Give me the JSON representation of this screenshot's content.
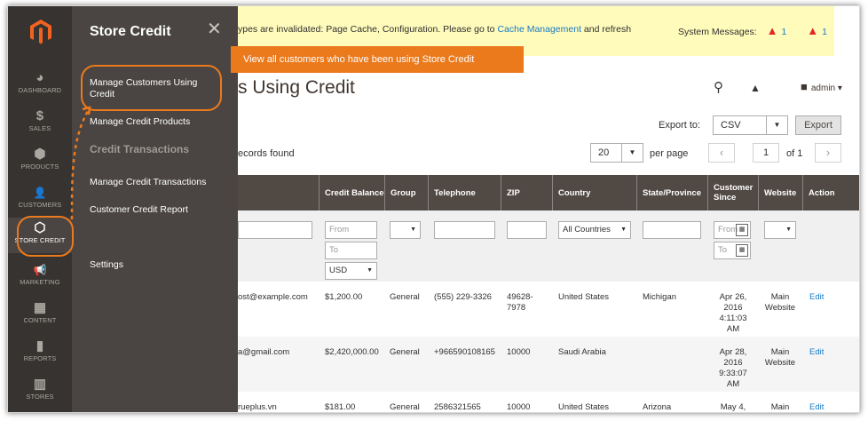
{
  "nav": {
    "items": [
      {
        "label": "DASHBOARD",
        "icon": "dashboard-icon",
        "glyph": "◕"
      },
      {
        "label": "SALES",
        "icon": "dollar-icon",
        "glyph": "$"
      },
      {
        "label": "PRODUCTS",
        "icon": "cube-icon",
        "glyph": "⬢"
      },
      {
        "label": "CUSTOMERS",
        "icon": "person-icon",
        "glyph": "👤"
      },
      {
        "label": "STORE CREDIT",
        "icon": "hexagon-icon",
        "glyph": "⬡"
      },
      {
        "label": "MARKETING",
        "icon": "megaphone-icon",
        "glyph": "📢"
      },
      {
        "label": "CONTENT",
        "icon": "layout-icon",
        "glyph": "▦"
      },
      {
        "label": "REPORTS",
        "icon": "bar-chart-icon",
        "glyph": "▮"
      },
      {
        "label": "STORES",
        "icon": "store-icon",
        "glyph": "▥"
      }
    ]
  },
  "flyout": {
    "title": "Store Credit",
    "close": "✕",
    "links": {
      "manage_customers": "Manage Customers Using Credit",
      "manage_products": "Manage Credit Products",
      "section": "Credit Transactions",
      "manage_transactions": "Manage Credit Transactions",
      "report": "Customer Credit Report",
      "settings": "Settings"
    }
  },
  "message": {
    "text": "ypes are invalidated: Page Cache, Configuration. Please go to ",
    "link": "Cache Management",
    "after": " and refresh",
    "system_label": "System Messages:",
    "count1": "1",
    "count2": "1"
  },
  "tooltip": "View all customers who have been using Store Credit",
  "page_title": "s Using Credit",
  "header": {
    "admin": "admin ▾"
  },
  "toolbar": {
    "export_label": "Export to:",
    "export_value": "CSV",
    "export_button": "Export",
    "records": "ecords found",
    "per_page_value": "20",
    "per_page_label": "per page",
    "page_value": "1",
    "of": "of 1"
  },
  "columns": [
    "Credit Balance",
    "Group",
    "Telephone",
    "ZIP",
    "Country",
    "State/Province",
    "Customer Since",
    "Website",
    "Action"
  ],
  "filters": {
    "from": "From",
    "to": "To",
    "currency": "USD",
    "country": "All Countries",
    "since_from": "From",
    "since_to": "To"
  },
  "rows": [
    {
      "email": "ost@example.com",
      "balance": "$1,200.00",
      "group": "General",
      "phone": "(555) 229-3326",
      "zip": "49628-7978",
      "country": "United States",
      "state": "Michigan",
      "since": "Apr 26, 2016 4:11:03 AM",
      "website": "Main Website",
      "action": "Edit"
    },
    {
      "email": "a@gmail.com",
      "balance": "$2,420,000.00",
      "group": "General",
      "phone": "+966590108165",
      "zip": "10000",
      "country": "Saudi Arabia",
      "state": "",
      "since": "Apr 28, 2016 9:33:07 AM",
      "website": "Main Website",
      "action": "Edit"
    },
    {
      "email": "rueplus.vn",
      "balance": "$181.00",
      "group": "General",
      "phone": "2586321565",
      "zip": "10000",
      "country": "United States",
      "state": "Arizona",
      "since": "May 4,",
      "website": "Main",
      "action": "Edit"
    }
  ]
}
